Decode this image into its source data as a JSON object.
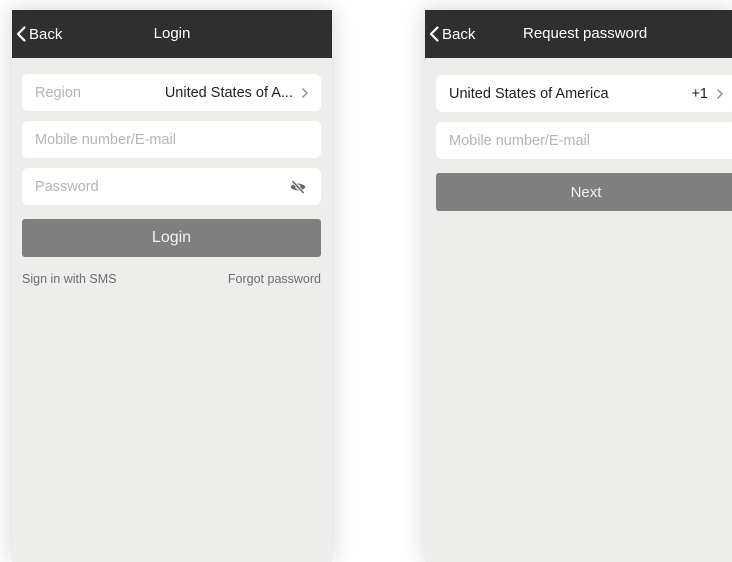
{
  "login_screen": {
    "back_label": "Back",
    "title": "Login",
    "region": {
      "label": "Region",
      "value": "United States of A..."
    },
    "account_placeholder": "Mobile number/E-mail",
    "password_placeholder": "Password",
    "login_button": "Login",
    "sms_link": "Sign in with SMS",
    "forgot_link": "Forgot password"
  },
  "request_screen": {
    "back_label": "Back",
    "title": "Request password",
    "country": "United States of America",
    "dial_code": "+1",
    "account_placeholder": "Mobile number/E-mail",
    "next_button": "Next"
  },
  "icons": {
    "back": "chevron-left-icon",
    "chevron": "chevron-right-icon",
    "password_toggle": "eye-slash-icon"
  },
  "colors": {
    "header": "#2f2f2f",
    "background": "#ededec",
    "button": "#7f7f7f",
    "placeholder": "#b5b5b5"
  }
}
